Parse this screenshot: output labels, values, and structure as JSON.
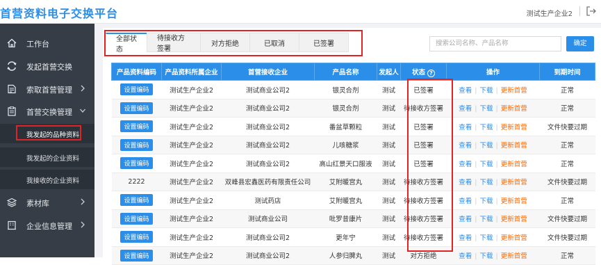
{
  "header": {
    "brand": "首营资料电子交换平台",
    "user": "测试生产企业2"
  },
  "sidebar": {
    "items": [
      {
        "label": "工作台",
        "icon": "home-icon"
      },
      {
        "label": "发起首营交换",
        "icon": "exchange-icon"
      },
      {
        "label": "索取首营管理",
        "icon": "document-request-icon"
      },
      {
        "label": "首营交换管理",
        "icon": "clipboard-icon"
      },
      {
        "label": "素材库",
        "icon": "layers-icon"
      },
      {
        "label": "企业信息管理",
        "icon": "building-icon"
      }
    ],
    "sub_items": [
      {
        "label": "我发起的品种资料"
      },
      {
        "label": "我发起的企业资料"
      },
      {
        "label": "我接收的企业资料"
      }
    ]
  },
  "tabs": [
    {
      "label": "全部状态"
    },
    {
      "label": "待接收方签署"
    },
    {
      "label": "对方拒绝"
    },
    {
      "label": "已取消"
    },
    {
      "label": "已签署"
    }
  ],
  "search": {
    "placeholder": "搜索公司名称、产品名称",
    "button": "确定"
  },
  "table": {
    "headers": [
      "产品资料编码",
      "产品资料所属企业",
      "首营接收企业",
      "产品名称",
      "发起人",
      "状态",
      "操作",
      "到期时间"
    ],
    "op_labels": {
      "view": "查看",
      "download": "下载",
      "update": "更新首营"
    },
    "code_button": "设置编码",
    "rows": [
      {
        "code": "",
        "owner": "测试生产企业2",
        "receiver": "测试商业公司2",
        "product": "银灵合剂",
        "initiator": "测试",
        "status": "已签署",
        "expiry": "正常"
      },
      {
        "code": "",
        "owner": "测试生产企业2",
        "receiver": "测试商业公司2",
        "product": "银灵合剂",
        "initiator": "测试",
        "status": "待接收方签署",
        "expiry": "正常"
      },
      {
        "code": "",
        "owner": "测试生产企业2",
        "receiver": "测试商业公司2",
        "product": "番盆草颗粒",
        "initiator": "测试",
        "status": "已签署",
        "expiry": "文件快要过期"
      },
      {
        "code": "",
        "owner": "测试生产企业2",
        "receiver": "测试商业公司2",
        "product": "儿咳糖浆",
        "initiator": "测试",
        "status": "已签署",
        "expiry": "正常"
      },
      {
        "code": "",
        "owner": "测试生产企业2",
        "receiver": "测试商业公司2",
        "product": "高山红景天口服液",
        "initiator": "测试",
        "status": "已签署",
        "expiry": "正常"
      },
      {
        "code": "2222",
        "owner": "测试生产企业2",
        "receiver": "双峰县宏鑫医药有限责任公司",
        "product": "艾附暖宫丸",
        "initiator": "测试",
        "status": "待接收方签署",
        "expiry": "文件快要过期"
      },
      {
        "code": "",
        "owner": "测试生产企业2",
        "receiver": "测试药店",
        "product": "艾附暖宫丸",
        "initiator": "测试",
        "status": "待接收方签署",
        "expiry": "正常"
      },
      {
        "code": "",
        "owner": "测试生产企业2",
        "receiver": "测试商业公司",
        "product": "吡罗昔康片",
        "initiator": "测试",
        "status": "待接收方签署",
        "expiry": "文件快要过期"
      },
      {
        "code": "",
        "owner": "测试生产企业2",
        "receiver": "测试商业公司2",
        "product": "更年宁",
        "initiator": "测试",
        "status": "待接收方签署",
        "expiry": "文件快要过期"
      },
      {
        "code": "",
        "owner": "测试生产企业2",
        "receiver": "测试商业公司2",
        "product": "人参归脾丸",
        "initiator": "测试",
        "status": "对方拒绝",
        "expiry": "正常"
      }
    ]
  }
}
